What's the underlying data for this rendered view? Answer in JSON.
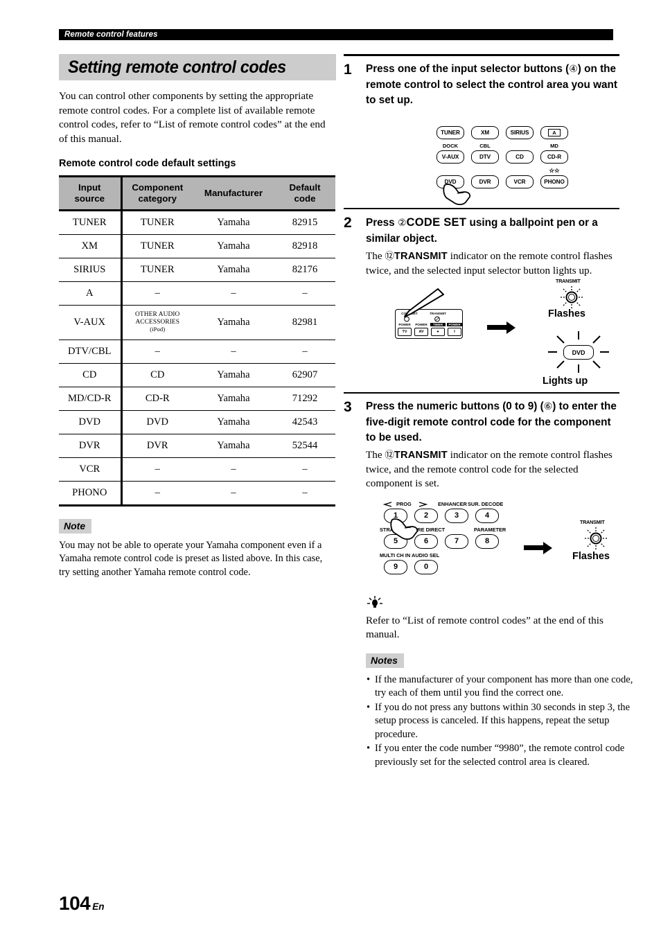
{
  "running_head": "Remote control features",
  "section": {
    "title": "Setting remote control codes",
    "intro": "You can control other components by setting the appropriate remote control codes. For a complete list of available remote control codes, refer to “List of remote control codes” at the end of this manual.",
    "sub_head": "Remote control code default settings"
  },
  "table": {
    "headers": [
      "Input source",
      "Component category",
      "Manufacturer",
      "Default code"
    ],
    "header_lines": [
      [
        "Input",
        "source"
      ],
      [
        "Component",
        "category"
      ],
      [
        "Manufacturer"
      ],
      [
        "Default",
        "code"
      ]
    ],
    "rows": [
      {
        "input": "TUNER",
        "category": "TUNER",
        "manufacturer": "Yamaha",
        "code": "82915"
      },
      {
        "input": "XM",
        "category": "TUNER",
        "manufacturer": "Yamaha",
        "code": "82918"
      },
      {
        "input": "SIRIUS",
        "category": "TUNER",
        "manufacturer": "Yamaha",
        "code": "82176"
      },
      {
        "input": "A",
        "category": "–",
        "manufacturer": "–",
        "code": "–"
      },
      {
        "input": "V-AUX",
        "category": "OTHER AUDIO ACCESSORIES (iPod)",
        "category_l1": "OTHER AUDIO",
        "category_l2": "ACCESSORIES",
        "category_l3": "(iPod)",
        "manufacturer": "Yamaha",
        "code": "82981"
      },
      {
        "input": "DTV/CBL",
        "category": "–",
        "manufacturer": "–",
        "code": "–"
      },
      {
        "input": "CD",
        "category": "CD",
        "manufacturer": "Yamaha",
        "code": "62907"
      },
      {
        "input": "MD/CD-R",
        "category": "CD-R",
        "manufacturer": "Yamaha",
        "code": "71292"
      },
      {
        "input": "DVD",
        "category": "DVD",
        "manufacturer": "Yamaha",
        "code": "42543"
      },
      {
        "input": "DVR",
        "category": "DVR",
        "manufacturer": "Yamaha",
        "code": "52544"
      },
      {
        "input": "VCR",
        "category": "–",
        "manufacturer": "–",
        "code": "–"
      },
      {
        "input": "PHONO",
        "category": "–",
        "manufacturer": "–",
        "code": "–"
      }
    ]
  },
  "note": {
    "label": "Note",
    "body": "You may not be able to operate your Yamaha component even if a Yamaha remote control code is preset as listed above. In this case, try setting another Yamaha remote control code."
  },
  "steps": [
    {
      "number": "1",
      "heading_pre": "Press one of the input selector buttons (",
      "heading_circnum": "④",
      "heading_post": ") on the remote control to select the control area you want to set up."
    },
    {
      "number": "2",
      "heading_pre": "Press ",
      "heading_circnum": "②",
      "heading_key": "CODE SET",
      "heading_post": " using a ballpoint pen or a similar object.",
      "body_pre": "The ",
      "body_circnum": "⑫",
      "body_key": "TRANSMIT",
      "body_post": " indicator on the remote control flashes twice, and the selected input selector button lights up."
    },
    {
      "number": "3",
      "heading_pre": "Press the numeric buttons (0 to 9) (",
      "heading_circnum": "⑥",
      "heading_post": ") to enter the five-digit remote control code for the component to be used.",
      "body_pre": "The ",
      "body_circnum": "⑫",
      "body_key": "TRANSMIT",
      "body_post": " indicator on the remote control flashes twice, and the remote control code for the selected component is set."
    }
  ],
  "input_selector_figure": {
    "row1": [
      "TUNER",
      "XM",
      "SIRIUS",
      "A"
    ],
    "row2_labels": [
      "DOCK",
      "CBL",
      "",
      "MD"
    ],
    "row2": [
      "V-AUX",
      "DTV",
      "CD",
      "CD-R"
    ],
    "row3_label": "☆☆",
    "row3": [
      "DVD",
      "DVR",
      "VCR",
      "PHONO"
    ]
  },
  "step2_figure": {
    "mini_remote_top_labels": [
      "CODE SET",
      "TRANSMIT"
    ],
    "mini_remote_labels": [
      "POWER",
      "POWER",
      "TIMER",
      "POWER"
    ],
    "mini_remote_buttons": [
      "TV",
      "AV",
      "●",
      "I"
    ],
    "transmit_label": "TRANSMIT",
    "flashes_caption": "Flashes",
    "lit_button": "DVD",
    "lights_up_caption": "Lights up"
  },
  "step3_figure": {
    "labels_row1": [
      "PROG",
      "ENHANCER",
      "SUR. DECODE"
    ],
    "labels_row2": [
      "STRAIGHT",
      "PURE DIRECT",
      "PARAMETER"
    ],
    "labels_row3": [
      "MULTI CH IN",
      "AUDIO SEL"
    ],
    "keys": [
      "1",
      "2",
      "3",
      "4",
      "5",
      "6",
      "7",
      "8",
      "9",
      "0"
    ],
    "transmit_label": "TRANSMIT",
    "flashes_caption": "Flashes"
  },
  "tip": {
    "body": "Refer to “List of remote control codes” at the end of this manual."
  },
  "notes": {
    "label": "Notes",
    "items": [
      "If the manufacturer of your component has more than one code, try each of them until you find the correct one.",
      "If you do not press any buttons within 30 seconds in step 3, the setup process is canceled. If this happens, repeat the setup procedure.",
      "If you enter the code number “9980”, the remote control code previously set for the selected control area is cleared."
    ]
  },
  "footer": {
    "page_number": "104",
    "language": "En"
  }
}
